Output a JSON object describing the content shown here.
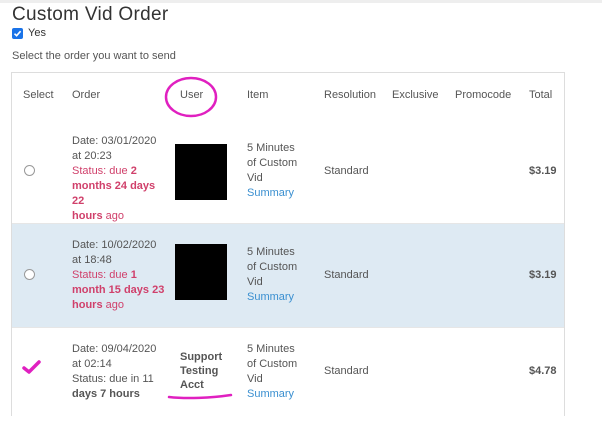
{
  "title": "Custom Vid Order",
  "yes_checkbox": {
    "label": "Yes",
    "checked": true
  },
  "instruction": "Select the order you want to send",
  "columns": {
    "select": "Select",
    "order": "Order",
    "user": "User",
    "item": "Item",
    "resolution": "Resolution",
    "exclusive": "Exclusive",
    "promocode": "Promocode",
    "total": "Total"
  },
  "rows": [
    {
      "selected": false,
      "date_line1": "Date: 03/01/2020",
      "date_line2": "at 20:23",
      "status_prefix": "Status: due ",
      "status_a": "2",
      "status_b": "months 24 days 22",
      "status_c": "hours",
      "status_suffix": " ago",
      "item_l1": "5 Minutes",
      "item_l2": "of Custom",
      "item_l3": "Vid",
      "summary": "Summary",
      "resolution": "Standard",
      "total": "$3.19"
    },
    {
      "selected": false,
      "date_line1": "Date: 10/02/2020",
      "date_line2": "at 18:48",
      "status_prefix": "Status: due ",
      "status_a": "1",
      "status_b": "month 15 days 23",
      "status_c": "hours",
      "status_suffix": " ago",
      "item_l1": "5 Minutes",
      "item_l2": "of Custom",
      "item_l3": "Vid",
      "summary": "Summary",
      "resolution": "Standard",
      "total": "$3.19"
    },
    {
      "selected": true,
      "date_line1": "Date: 09/04/2020",
      "date_line2": "at 02:14",
      "status_l1": "Status: due in 11",
      "status_l2": "days 7 hours",
      "user_l1": "Support",
      "user_l2": "Testing",
      "user_l3": "Acct",
      "item_l1": "5 Minutes",
      "item_l2": "of Custom",
      "item_l3": "Vid",
      "summary": "Summary",
      "resolution": "Standard",
      "total": "$4.78"
    }
  ],
  "colors": {
    "accent": "#1a73e8",
    "status_red": "#d0406b",
    "link": "#3a8fd0",
    "selected_row_bg": "#deeaf3",
    "annotation": "#e020c0"
  }
}
